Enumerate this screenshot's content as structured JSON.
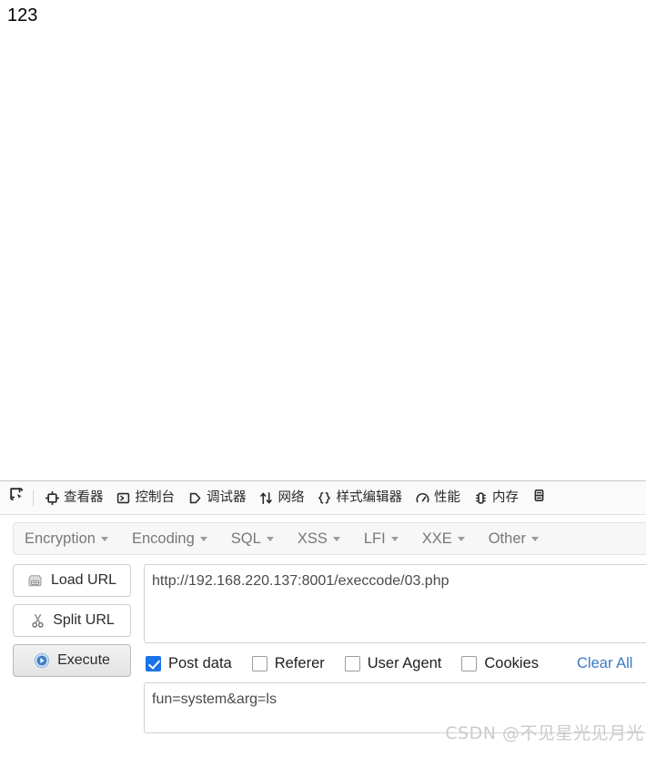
{
  "page": {
    "output_text": "123"
  },
  "devtools": {
    "picker_icon": "element-picker-icon",
    "tabs": [
      {
        "label": "查看器",
        "icon": "inspector-icon"
      },
      {
        "label": "控制台",
        "icon": "console-icon"
      },
      {
        "label": "调试器",
        "icon": "debugger-icon"
      },
      {
        "label": "网络",
        "icon": "network-icon"
      },
      {
        "label": "样式编辑器",
        "icon": "style-editor-icon"
      },
      {
        "label": "性能",
        "icon": "performance-icon"
      },
      {
        "label": "内存",
        "icon": "memory-icon"
      }
    ],
    "end_icon": "storage-icon"
  },
  "hackbar": {
    "menu": [
      {
        "label": "Encryption"
      },
      {
        "label": "Encoding"
      },
      {
        "label": "SQL"
      },
      {
        "label": "XSS"
      },
      {
        "label": "LFI"
      },
      {
        "label": "XXE"
      },
      {
        "label": "Other"
      }
    ],
    "buttons": [
      {
        "label": "Load URL",
        "icon": "load-url-icon",
        "active": false
      },
      {
        "label": "Split URL",
        "icon": "split-url-icon",
        "active": false
      },
      {
        "label": "Execute",
        "icon": "execute-icon",
        "active": true
      }
    ],
    "url_field": {
      "value": "http://192.168.220.137:8001/execcode/03.php",
      "placeholder": ""
    },
    "checkboxes": [
      {
        "label": "Post data",
        "checked": true
      },
      {
        "label": "Referer",
        "checked": false
      },
      {
        "label": "User Agent",
        "checked": false
      },
      {
        "label": "Cookies",
        "checked": false
      }
    ],
    "clear_all_label": "Clear All",
    "post_field": {
      "value": "fun=system&arg=ls",
      "placeholder": ""
    }
  },
  "watermark": {
    "text": "CSDN @不见星光见月光"
  },
  "colors": {
    "accent_blue": "#1a73e8",
    "link_blue": "#3b78c3",
    "toolbar_bg": "#fafafa",
    "menu_bg": "#f7f7f7"
  }
}
